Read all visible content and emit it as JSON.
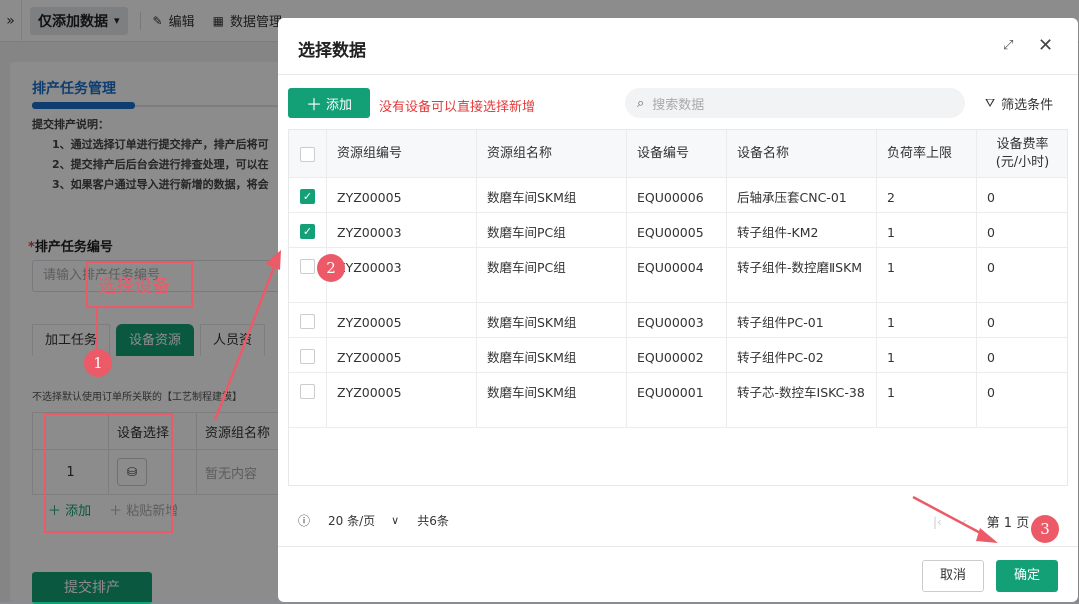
{
  "toolbar": {
    "expand_icon": "»",
    "mode_label": "仅添加数据",
    "edit_label": "编辑",
    "data_manage_label": "数据管理"
  },
  "left_page": {
    "title": "排产任务管理",
    "note_heading": "提交排产说明：",
    "notes": [
      "1、通过选择订单进行提交排产，排产后将可",
      "2、提交排产后后台会进行排查处理，可以在",
      "3、如果客户通过导入进行新增的数据，将会"
    ],
    "task_no_label": "排产任务编号",
    "task_no_placeholder": "请输入排产任务编号",
    "tabs": [
      "加工任务",
      "设备资源",
      "人员资"
    ],
    "tip": "不选择默认使用订单所关联的【工艺制程建模】",
    "mini_table": {
      "headers": [
        "",
        "设备选择",
        "资源组名称"
      ],
      "row_index": "1",
      "empty_text": "暂无内容"
    },
    "add_label": "添加",
    "paste_label": "粘贴新增",
    "submit_label": "提交排产"
  },
  "modal": {
    "title": "选择数据",
    "add_label": "添加",
    "hint": "没有设备可以直接选择新增",
    "search_placeholder": "搜索数据",
    "filter_label": "筛选条件",
    "columns": [
      "资源组编号",
      "资源组名称",
      "设备编号",
      "设备名称",
      "负荷率上限",
      "设备费率\n(元/小时)"
    ],
    "rows": [
      {
        "checked": true,
        "group_no": "ZYZ00005",
        "group_name": "数磨车间SKM组",
        "equip_no": "EQU00006",
        "equip_name": "后轴承压套CNC-01",
        "load": "2",
        "rate": "0"
      },
      {
        "checked": true,
        "group_no": "ZYZ00003",
        "group_name": "数磨车间PC组",
        "equip_no": "EQU00005",
        "equip_name": "转子组件-KM2",
        "load": "1",
        "rate": "0"
      },
      {
        "checked": false,
        "group_no": "ZYZ00003",
        "group_name": "数磨车间PC组",
        "equip_no": "EQU00004",
        "equip_name": "转子组件-数控磨ⅡSKM",
        "load": "1",
        "rate": "0"
      },
      {
        "checked": false,
        "group_no": "ZYZ00005",
        "group_name": "数磨车间SKM组",
        "equip_no": "EQU00003",
        "equip_name": "转子组件PC-01",
        "load": "1",
        "rate": "0"
      },
      {
        "checked": false,
        "group_no": "ZYZ00005",
        "group_name": "数磨车间SKM组",
        "equip_no": "EQU00002",
        "equip_name": "转子组件PC-02",
        "load": "1",
        "rate": "0"
      },
      {
        "checked": false,
        "group_no": "ZYZ00005",
        "group_name": "数磨车间SKM组",
        "equip_no": "EQU00001",
        "equip_name": "转子芯-数控车ⅠSKC-38",
        "load": "1",
        "rate": "0"
      }
    ],
    "page_size": "20 条/页",
    "total": "共6条",
    "page_label": "第 1 页",
    "cancel_label": "取消",
    "ok_label": "确定"
  },
  "annotations": {
    "select_equipment": "选择设备",
    "step1": "1",
    "step2": "2",
    "step3": "3"
  },
  "colors": {
    "primary": "#14a077",
    "blue": "#1d6fcc",
    "annotation": "#ec5a68"
  }
}
